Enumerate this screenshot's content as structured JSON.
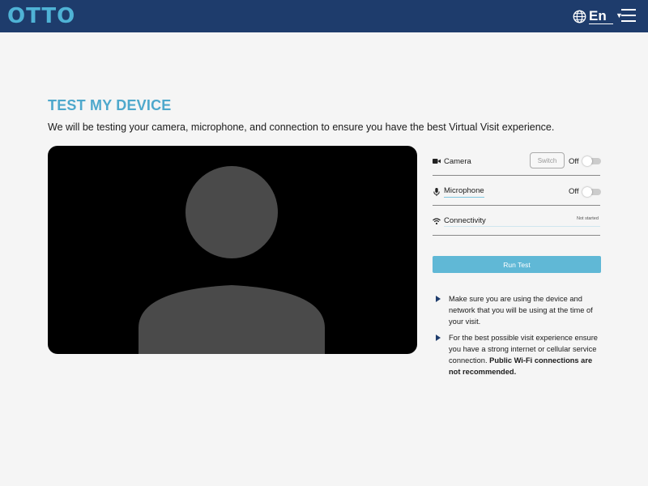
{
  "header": {
    "logo": "OTTO",
    "language": "En",
    "icons": {
      "globe": "globe-icon",
      "caret": "caret-down-icon",
      "menu": "hamburger-menu-icon"
    },
    "colors": {
      "bar": "#1e3c6c",
      "logo": "#4fb3d6"
    }
  },
  "page": {
    "title": "TEST MY DEVICE",
    "subtitle": "We will be testing your camera, microphone, and connection to ensure you have the best Virtual Visit experience."
  },
  "video": {
    "placeholder": "person-silhouette-icon",
    "background": "#000000"
  },
  "devices": {
    "camera": {
      "label": "Camera",
      "switch_label": "Switch",
      "state": "Off",
      "icon": "camera-icon"
    },
    "microphone": {
      "label": "Microphone",
      "state": "Off",
      "icon": "microphone-icon"
    },
    "connectivity": {
      "label": "Connectivity",
      "status": "Not started",
      "icon": "wifi-icon"
    }
  },
  "run_test": {
    "label": "Run Test",
    "color": "#60b8d6"
  },
  "tips": [
    {
      "text": "Make sure you are using the device and network that you will be using at the time of your visit.",
      "bold": ""
    },
    {
      "text": "For the best possible visit experience ensure you have a strong internet or cellular service connection. ",
      "bold": "Public Wi-Fi connections are not recommended."
    }
  ]
}
